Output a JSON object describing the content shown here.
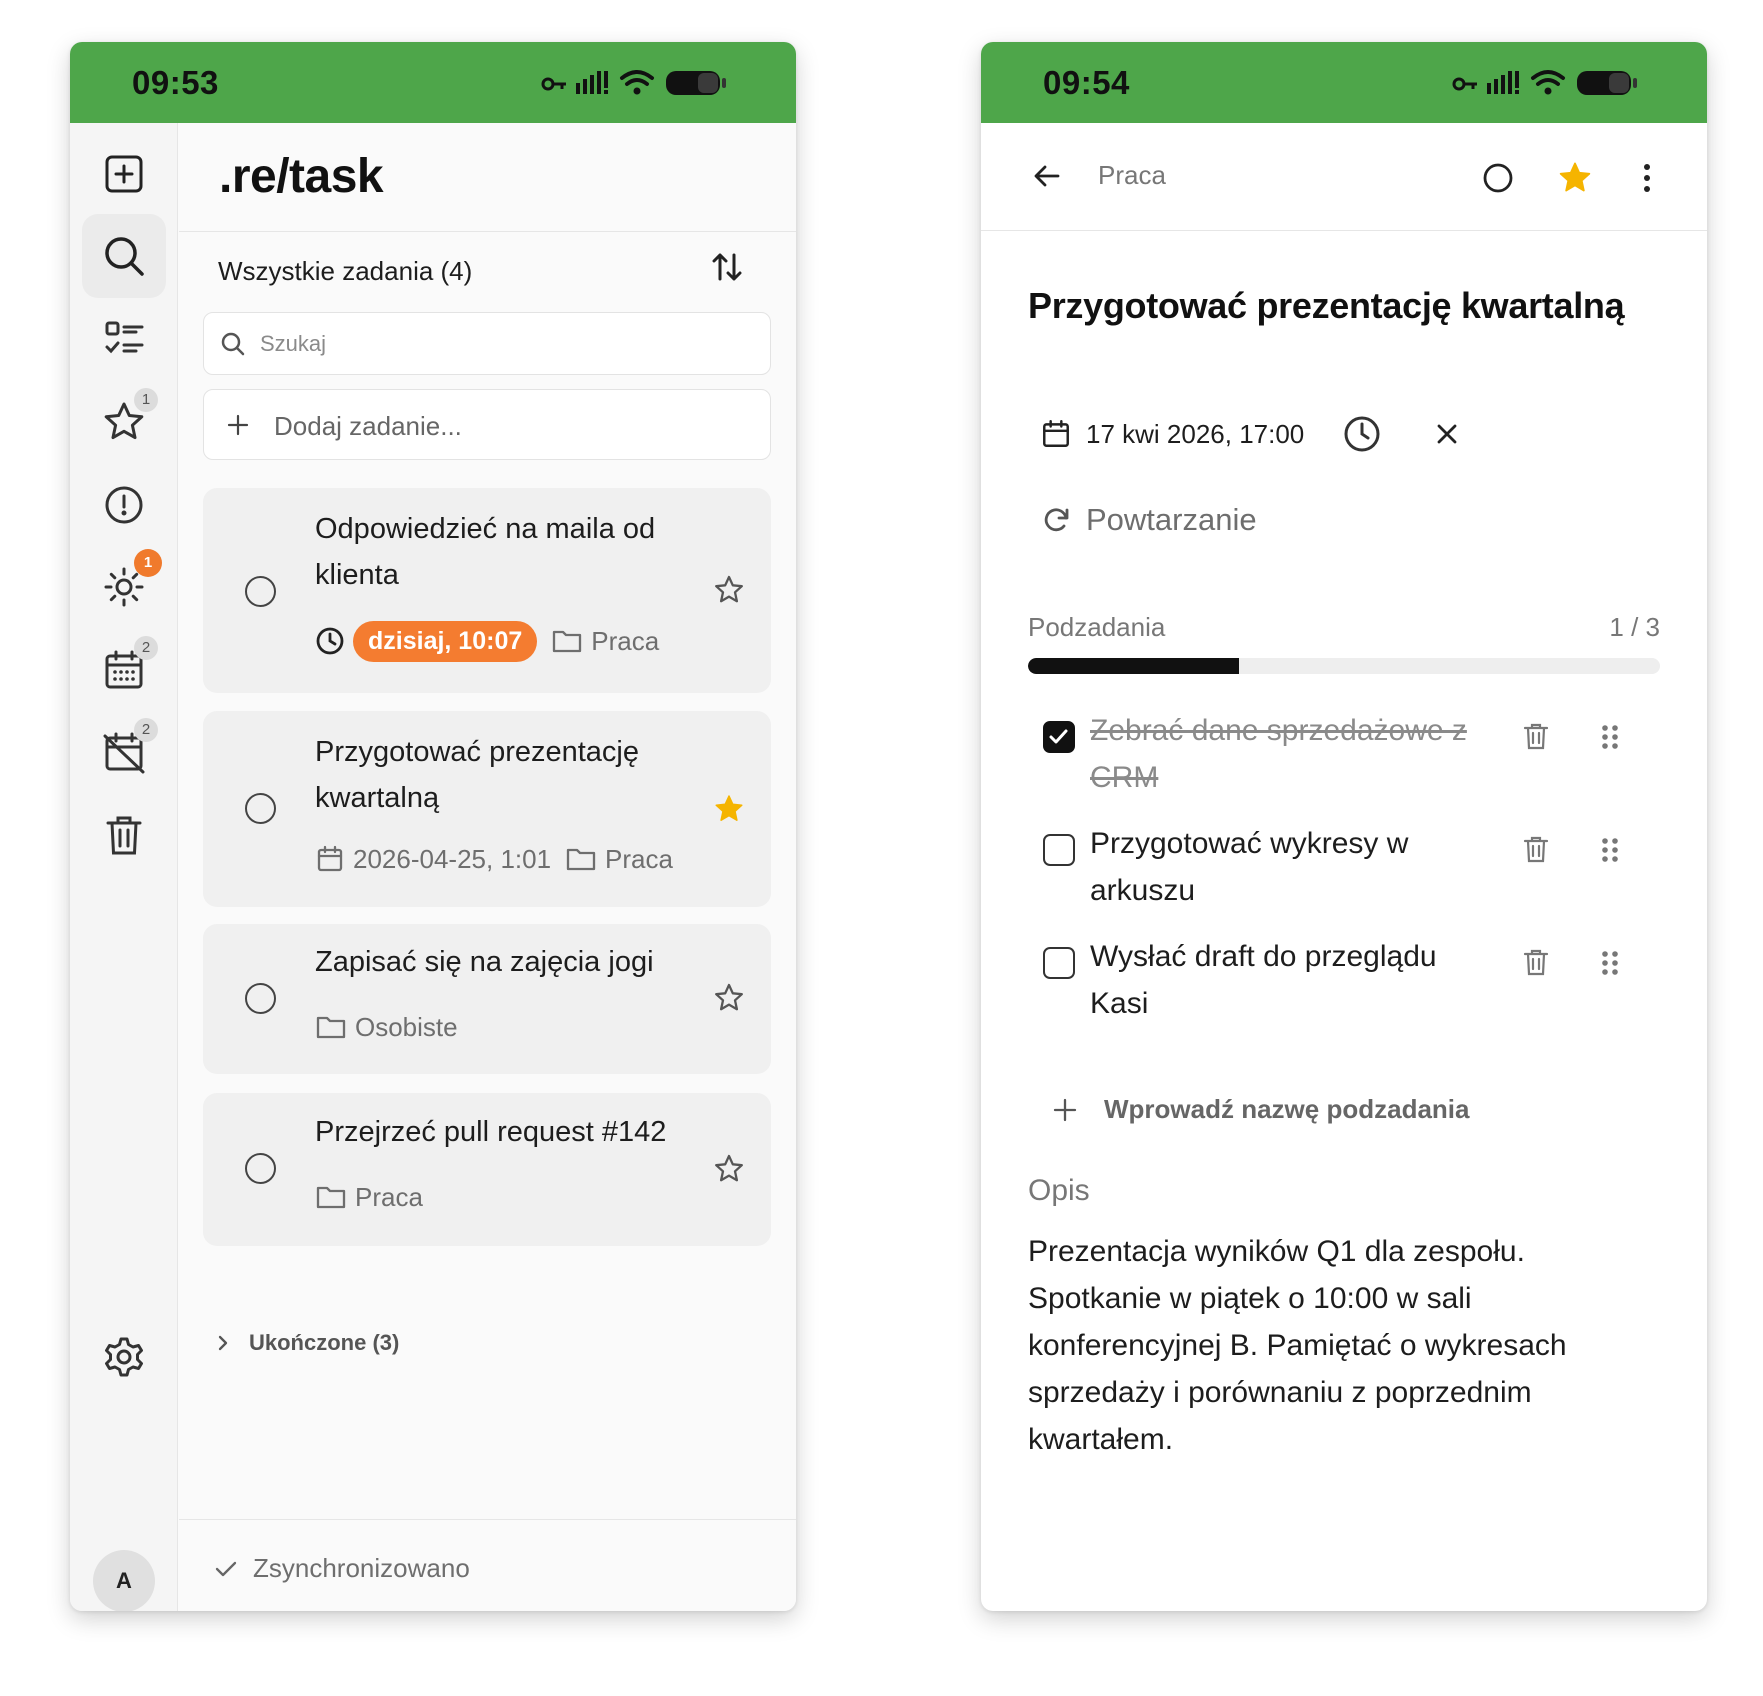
{
  "left": {
    "status_time": "09:53",
    "logo": ".re/task",
    "list_title": "Wszystkie zadania (4)",
    "search_placeholder": "Szukaj",
    "add_placeholder": "Dodaj zadanie...",
    "rail_badges": {
      "starred": "1",
      "today": "1",
      "planned": "2",
      "overdue": "2"
    },
    "avatar": "A",
    "tasks": [
      {
        "title": "Odpowiedzieć na maila od klienta",
        "due": "dzisiaj, 10:07",
        "list": "Praca",
        "starred": false
      },
      {
        "title": "Przygotować prezentację kwartalną",
        "date": "2026-04-25, 1:01",
        "list": "Praca",
        "starred": true
      },
      {
        "title": "Zapisać się na zajęcia jogi",
        "list": "Osobiste",
        "starred": false
      },
      {
        "title": "Przejrzeć pull request #142",
        "list": "Praca",
        "starred": false
      }
    ],
    "completed_label": "Ukończone (3)",
    "sync_label": "Zsynchronizowano"
  },
  "right": {
    "status_time": "09:54",
    "breadcrumb": "Praca",
    "title": "Przygotować prezentację kwartalną",
    "due": "17 kwi 2026, 17:00",
    "repeat_label": "Powtarzanie",
    "subtasks_label": "Podzadania",
    "subtasks_count": "1 / 3",
    "subtasks_progress": 0.3333,
    "subtasks": [
      {
        "text": "Zebrać dane sprzedażowe z CRM",
        "done": true
      },
      {
        "text": "Przygotować wykresy w arkuszu",
        "done": false
      },
      {
        "text": "Wysłać draft do przeglądu Kasi",
        "done": false
      }
    ],
    "add_subtask_placeholder": "Wprowadź nazwę podzadania",
    "description_label": "Opis",
    "description": "Prezentacja wyników Q1 dla zespołu. Spotkanie w piątek o 10:00 w sali konferencyjnej B. Pamiętać o wykresach sprzedaży i porównaniu z poprzednim kwartałem."
  },
  "colors": {
    "statusbar": "#4ea64a",
    "accent_orange": "#f47c30",
    "star_active": "#f5b400"
  }
}
